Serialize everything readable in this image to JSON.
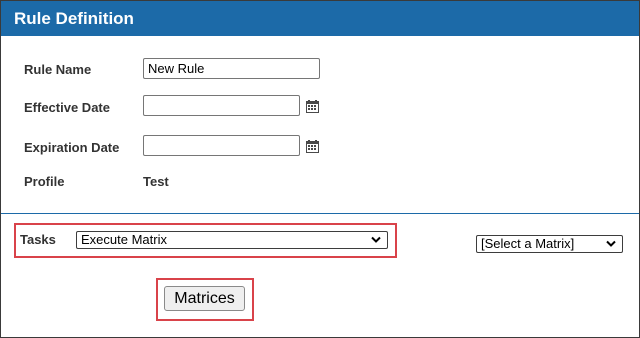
{
  "header": {
    "title": "Rule Definition"
  },
  "form": {
    "rule_name": {
      "label": "Rule Name",
      "value": "New Rule"
    },
    "effective_date": {
      "label": "Effective Date",
      "value": "",
      "icon": "calendar-icon"
    },
    "expiration_date": {
      "label": "Expiration Date",
      "value": "",
      "icon": "calendar-icon"
    },
    "profile": {
      "label": "Profile",
      "value": "Test"
    }
  },
  "tasks": {
    "label": "Tasks",
    "selected": "Execute Matrix",
    "icon": "chevron-down-icon"
  },
  "matrix_select": {
    "selected": "[Select a Matrix]",
    "icon": "chevron-down-icon"
  },
  "matrices_button": {
    "label": "Matrices"
  },
  "colors": {
    "header_bg": "#1c6aa8",
    "header_text": "#ffffff",
    "highlight": "#d9434a",
    "divider": "#1c6aa8"
  }
}
